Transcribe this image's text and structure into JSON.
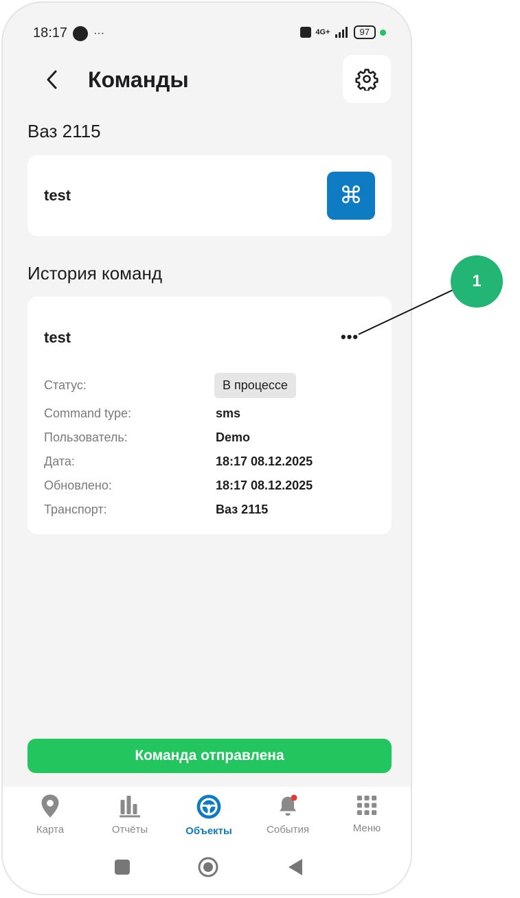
{
  "status_bar": {
    "time": "18:17",
    "more": "···",
    "network": "4G+",
    "battery": "97"
  },
  "header": {
    "title": "Команды"
  },
  "vehicle": {
    "name": "Ваз 2115"
  },
  "command": {
    "name": "test"
  },
  "history": {
    "title": "История команд",
    "item": {
      "name": "test",
      "more": "•••",
      "rows": [
        {
          "label": "Статус:",
          "value": "В процессе"
        },
        {
          "label": "Command type:",
          "value": "sms"
        },
        {
          "label": "Пользователь:",
          "value": "Demo"
        },
        {
          "label": "Дата:",
          "value": "18:17 08.12.2025"
        },
        {
          "label": "Обновлено:",
          "value": "18:17 08.12.2025"
        },
        {
          "label": "Транспорт:",
          "value": "Ваз 2115"
        }
      ]
    }
  },
  "toast": {
    "text": "Команда отправлена"
  },
  "tabs": [
    {
      "label": "Карта",
      "icon": "map-pin-icon"
    },
    {
      "label": "Отчёты",
      "icon": "bar-chart-icon"
    },
    {
      "label": "Объекты",
      "icon": "steering-wheel-icon",
      "active": true
    },
    {
      "label": "События",
      "icon": "bell-icon"
    },
    {
      "label": "Меню",
      "icon": "grid-icon"
    }
  ],
  "callout": {
    "number": "1"
  },
  "colors": {
    "accent": "#0f7bc2",
    "success": "#22c55e",
    "callout": "#22b573",
    "background": "#f4f4f4"
  }
}
